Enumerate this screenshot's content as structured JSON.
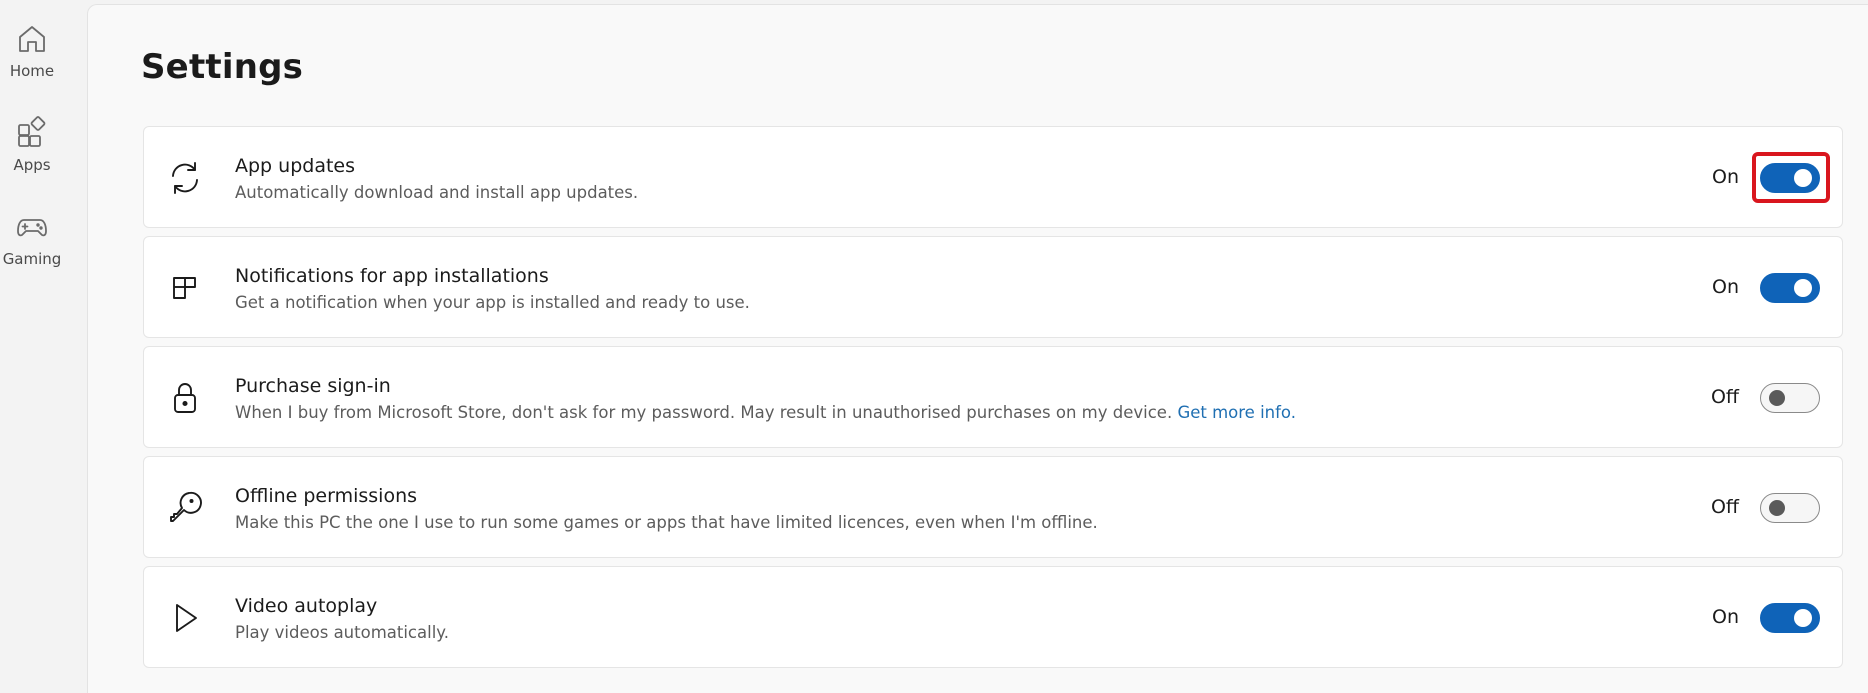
{
  "nav": {
    "items": [
      {
        "label": "Home",
        "icon": "home-icon"
      },
      {
        "label": "Apps",
        "icon": "apps-icon"
      },
      {
        "label": "Gaming",
        "icon": "gaming-icon"
      }
    ]
  },
  "page": {
    "title": "Settings"
  },
  "settings": [
    {
      "title": "App updates",
      "description": "Automatically download and install app updates.",
      "link": "",
      "state_label": "On",
      "enabled": true,
      "icon": "refresh-icon",
      "highlighted": true
    },
    {
      "title": "Notifications for app installations",
      "description": "Get a notification when your app is installed and ready to use.",
      "link": "",
      "state_label": "On",
      "enabled": true,
      "icon": "notification-layout-icon",
      "highlighted": false
    },
    {
      "title": "Purchase sign-in",
      "description": "When I buy from Microsoft Store, don't ask for my password. May result in unauthorised purchases on my device. ",
      "link": "Get more info.",
      "state_label": "Off",
      "enabled": false,
      "icon": "lock-icon",
      "highlighted": false
    },
    {
      "title": "Offline permissions",
      "description": "Make this PC the one I use to run some games or apps that have limited licences, even when I'm offline.",
      "link": "",
      "state_label": "Off",
      "enabled": false,
      "icon": "key-icon",
      "highlighted": false
    },
    {
      "title": "Video autoplay",
      "description": "Play videos automatically.",
      "link": "",
      "state_label": "On",
      "enabled": true,
      "icon": "play-icon",
      "highlighted": false
    }
  ],
  "colors": {
    "accent": "#0f63b8",
    "link": "#1f6fb2",
    "highlight": "#d9161e",
    "background": "#f3f3f3",
    "card": "#ffffff"
  }
}
